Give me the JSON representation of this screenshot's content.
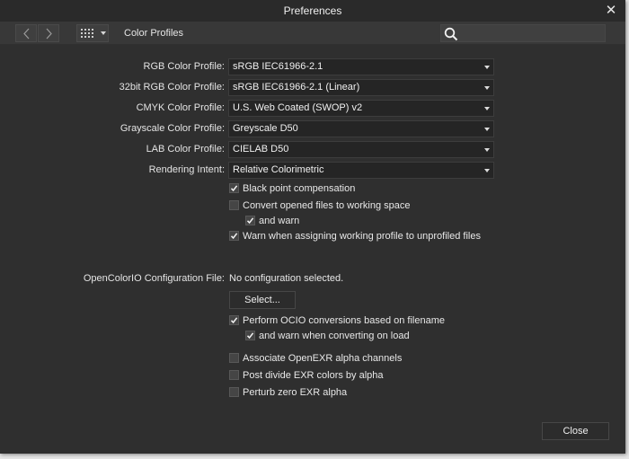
{
  "window": {
    "title": "Preferences"
  },
  "toolbar": {
    "section_title": "Color Profiles",
    "search_placeholder": ""
  },
  "profiles": [
    {
      "label": "RGB Color Profile:",
      "value": "sRGB IEC61966-2.1"
    },
    {
      "label": "32bit RGB Color Profile:",
      "value": "sRGB IEC61966-2.1 (Linear)"
    },
    {
      "label": "CMYK Color Profile:",
      "value": "U.S. Web Coated (SWOP) v2"
    },
    {
      "label": "Grayscale Color Profile:",
      "value": "Greyscale D50"
    },
    {
      "label": "LAB Color Profile:",
      "value": "CIELAB D50"
    },
    {
      "label": "Rendering Intent:",
      "value": "Relative Colorimetric"
    }
  ],
  "options": [
    {
      "label": "Black point compensation",
      "checked": true
    },
    {
      "label": "Convert opened files to working space",
      "checked": false
    },
    {
      "label": "and warn",
      "checked": true
    },
    {
      "label": "Warn when assigning working profile to unprofiled files",
      "checked": true
    }
  ],
  "ocio": {
    "label": "OpenColorIO Configuration File:",
    "value": "No configuration selected.",
    "select_label": "Select..."
  },
  "ocio_options": [
    {
      "label": "Perform OCIO conversions based on filename",
      "checked": true
    },
    {
      "label": "and warn when converting on load",
      "checked": true
    },
    {
      "label": "Associate OpenEXR alpha channels",
      "checked": false
    },
    {
      "label": "Post divide EXR colors by alpha",
      "checked": false
    },
    {
      "label": "Perturb zero EXR alpha",
      "checked": false
    }
  ],
  "footer": {
    "close_label": "Close"
  }
}
